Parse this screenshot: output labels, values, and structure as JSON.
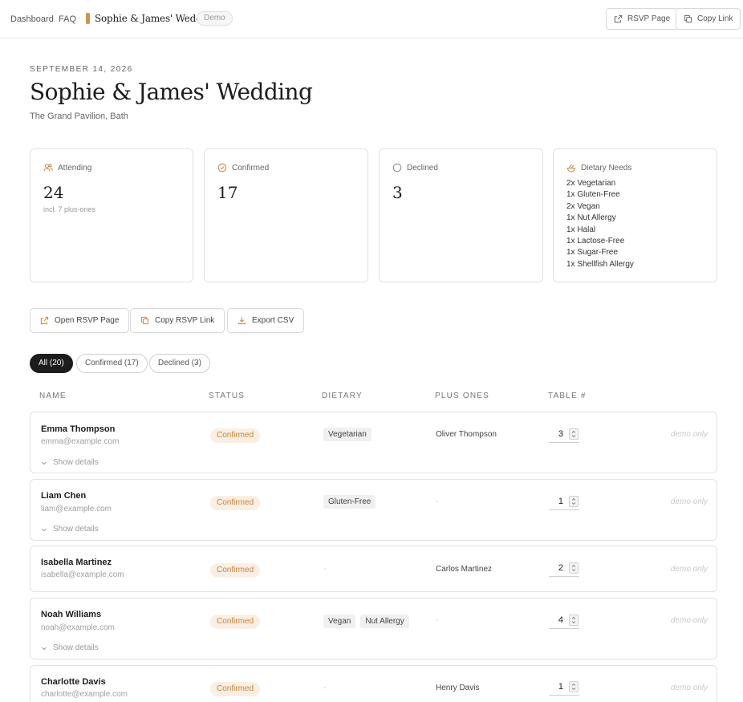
{
  "nav": {
    "crumbs": [
      "Dashboard",
      "FAQ"
    ],
    "event_name": "Sophie & James' Wedding",
    "demo_badge": "Demo",
    "rsvp_page_label": "RSVP Page",
    "copy_link_label": "Copy Link",
    "event_color": "#c9964f"
  },
  "event": {
    "date": "SEPTEMBER 14, 2026",
    "title": "Sophie & James' Wedding",
    "venue": "The Grand Pavilion, Bath"
  },
  "stats": {
    "attending": {
      "label": "Attending",
      "value": "24",
      "sub": "incl. 7 plus-ones",
      "icon": "users-icon"
    },
    "confirmed": {
      "label": "Confirmed",
      "value": "17",
      "icon": "check-circle-icon"
    },
    "declined": {
      "label": "Declined",
      "value": "3",
      "icon": "circle-icon"
    },
    "dietary": {
      "label": "Dietary Needs",
      "icon": "salad-icon",
      "items": [
        "2x Vegetarian",
        "1x Gluten-Free",
        "2x Vegan",
        "1x Nut Allergy",
        "1x Halal",
        "1x Lactose-Free",
        "1x Sugar-Free",
        "1x Shellfish Allergy"
      ]
    }
  },
  "actions": {
    "open_rsvp": "Open RSVP Page",
    "copy_rsvp": "Copy RSVP Link",
    "export_csv": "Export CSV"
  },
  "filters": [
    "All (20)",
    "Confirmed (17)",
    "Declined (3)"
  ],
  "columns": [
    "NAME",
    "STATUS",
    "DIETARY",
    "PLUS ONES",
    "TABLE #"
  ],
  "guests": [
    {
      "name": "Emma Thompson",
      "email": "emma@example.com",
      "status": "Confirmed",
      "dietary": [
        "Vegetarian"
      ],
      "plus_one": "Oliver Thompson",
      "table": "3",
      "note": "demo only",
      "details": "Show details"
    },
    {
      "name": "Liam Chen",
      "email": "liam@example.com",
      "status": "Confirmed",
      "dietary": [
        "Gluten-Free"
      ],
      "plus_one": "-",
      "table": "1",
      "note": "demo only",
      "details": "Show details"
    },
    {
      "name": "Isabella Martinez",
      "email": "isabella@example.com",
      "status": "Confirmed",
      "dietary": [],
      "plus_one": "Carlos Martinez",
      "table": "2",
      "note": "demo only",
      "details": ""
    },
    {
      "name": "Noah Williams",
      "email": "noah@example.com",
      "status": "Confirmed",
      "dietary": [
        "Vegan",
        "Nut Allergy"
      ],
      "plus_one": "-",
      "table": "4",
      "note": "demo only",
      "details": "Show details"
    },
    {
      "name": "Charlotte Davis",
      "email": "charlotte@example.com",
      "status": "Confirmed",
      "dietary": [],
      "plus_one": "Henry Davis",
      "table": "1",
      "note": "demo only",
      "details": ""
    }
  ],
  "empty_value": "-",
  "accent_color": "#c6853d"
}
